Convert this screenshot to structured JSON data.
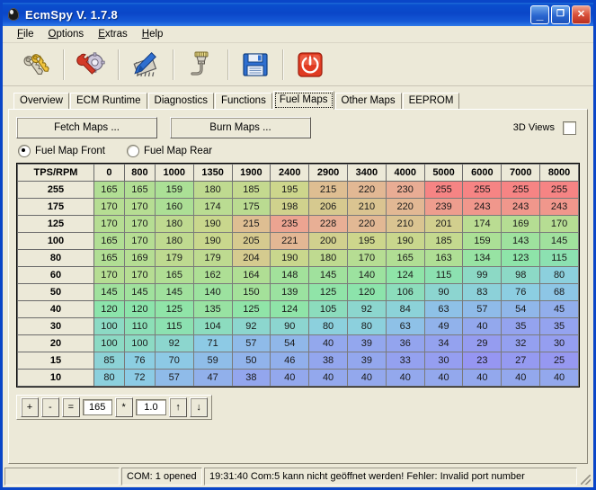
{
  "window": {
    "title": "EcmSpy V. 1.7.8",
    "icon": "shield-icon",
    "minimize_label": "_",
    "maximize_label": "❐",
    "close_label": "✕",
    "titlebar_color": "#0a46c8",
    "face_color": "#ece9d8"
  },
  "menu": [
    {
      "label": "File",
      "accel": "F"
    },
    {
      "label": "Options",
      "accel": "O"
    },
    {
      "label": "Extras",
      "accel": "E"
    },
    {
      "label": "Help",
      "accel": "H"
    }
  ],
  "toolbar": [
    {
      "name": "keys-icon",
      "tooltip": "Keys"
    },
    {
      "name": "wrench-gear-icon",
      "tooltip": "Settings"
    },
    {
      "name": "chip-icon",
      "tooltip": "Read ECM"
    },
    {
      "name": "lambda-sensor-icon",
      "tooltip": "Sensor"
    },
    {
      "name": "floppy-save-icon",
      "tooltip": "Save"
    },
    {
      "name": "power-button-icon",
      "tooltip": "Exit"
    }
  ],
  "tabs": [
    {
      "label": "Overview",
      "active": false
    },
    {
      "label": "ECM Runtime",
      "active": false
    },
    {
      "label": "Diagnostics",
      "active": false
    },
    {
      "label": "Functions",
      "active": false
    },
    {
      "label": "Fuel Maps",
      "active": true
    },
    {
      "label": "Other Maps",
      "active": false
    },
    {
      "label": "EEPROM",
      "active": false
    }
  ],
  "actions": {
    "fetch_maps": "Fetch Maps ...",
    "burn_maps": "Burn Maps ...",
    "views_3d_label": "3D Views",
    "views_3d_checked": false
  },
  "map_select": {
    "front": "Fuel Map Front",
    "rear": "Fuel Map Rear",
    "selected": "front"
  },
  "calcbar": {
    "plus": "+",
    "minus": "-",
    "equals": "=",
    "value": "165",
    "multiply": "*",
    "factor": "1.0",
    "up": "↑",
    "down": "↓"
  },
  "status": {
    "pane_blank": "",
    "com": "COM: 1 opened",
    "message": "19:31:40 Com:5 kann nicht geöffnet werden! Fehler: Invalid port number"
  },
  "chart_data": {
    "type": "heatmap",
    "title": "Fuel Map Front",
    "corner_label": "TPS/RPM",
    "xlabel": "RPM",
    "ylabel": "TPS",
    "categories": [
      "0",
      "800",
      "1000",
      "1350",
      "1900",
      "2400",
      "2900",
      "3400",
      "4000",
      "5000",
      "6000",
      "7000",
      "8000"
    ],
    "rows": [
      "255",
      "175",
      "125",
      "100",
      "80",
      "60",
      "50",
      "40",
      "30",
      "20",
      "15",
      "10"
    ],
    "values": [
      [
        165,
        165,
        159,
        180,
        185,
        195,
        215,
        220,
        230,
        255,
        255,
        255,
        255
      ],
      [
        170,
        170,
        160,
        174,
        175,
        198,
        206,
        210,
        220,
        239,
        243,
        243,
        243
      ],
      [
        170,
        170,
        180,
        190,
        215,
        235,
        228,
        220,
        210,
        201,
        174,
        169,
        170
      ],
      [
        165,
        170,
        180,
        190,
        205,
        221,
        200,
        195,
        190,
        185,
        159,
        143,
        145
      ],
      [
        165,
        169,
        179,
        179,
        204,
        190,
        180,
        170,
        165,
        163,
        134,
        123,
        115
      ],
      [
        170,
        170,
        165,
        162,
        164,
        148,
        145,
        140,
        124,
        115,
        99,
        98,
        80
      ],
      [
        145,
        145,
        145,
        140,
        150,
        139,
        125,
        120,
        106,
        90,
        83,
        76,
        68
      ],
      [
        120,
        120,
        125,
        135,
        125,
        124,
        105,
        92,
        84,
        63,
        57,
        54,
        45
      ],
      [
        100,
        110,
        115,
        104,
        92,
        90,
        80,
        80,
        63,
        49,
        40,
        35,
        35
      ],
      [
        100,
        100,
        92,
        71,
        57,
        54,
        40,
        39,
        36,
        34,
        29,
        32,
        30
      ],
      [
        85,
        76,
        70,
        59,
        50,
        46,
        38,
        39,
        33,
        30,
        23,
        27,
        25
      ],
      [
        80,
        72,
        57,
        47,
        38,
        40,
        40,
        40,
        40,
        40,
        40,
        40,
        40
      ]
    ],
    "colorscale": {
      "low": "#9b9bf0",
      "mid_low": "#8fe0d8",
      "mid": "#8ee88e",
      "mid_high": "#d8d88a",
      "high": "#f48a8a",
      "min": 23,
      "max": 255
    },
    "grid": true,
    "legend": "none"
  }
}
